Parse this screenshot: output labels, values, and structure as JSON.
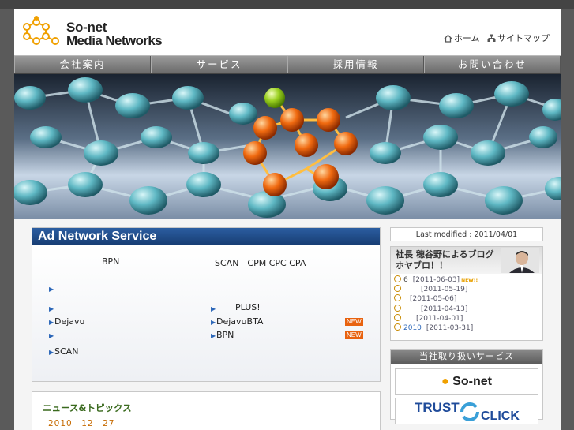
{
  "header": {
    "logo_line1": "So-net",
    "logo_line2": "Media Networks",
    "home_link": "ホーム",
    "sitemap_link": "サイトマップ"
  },
  "nav": [
    "会社案内",
    "サービス",
    "採用情報",
    "お問い合わせ"
  ],
  "ad_network": {
    "title": "Ad Network Service",
    "bpn": "BPN",
    "scan_line": "SCAN　CPM CPC CPA",
    "plus": "PLUS!",
    "dejavu": "Dejavu",
    "dejavubta": "DejavuBTA",
    "bpn2": "BPN",
    "scan": "SCAN",
    "new_badge": "NEW"
  },
  "news": {
    "heading": "ニュース&トピックス",
    "date": "2010　12　27"
  },
  "sidebar": {
    "last_modified": "Last modified : 2011/04/01",
    "blog_title_line1": "社長 穂谷野によるブログ",
    "blog_title_line2": "ホヤブロ！！",
    "blog_items": [
      {
        "prefix": "6",
        "date": "[2011-06-03]",
        "new": "NEW!!"
      },
      {
        "prefix": "",
        "date": "[2011-05-19]",
        "new": ""
      },
      {
        "prefix": "",
        "date": "[2011-05-06]",
        "new": ""
      },
      {
        "prefix": "",
        "date": "[2011-04-13]",
        "new": ""
      },
      {
        "prefix": "",
        "date": "[2011-04-01]",
        "new": ""
      },
      {
        "prefix": "2010",
        "date": "[2011-03-31]",
        "new": ""
      }
    ],
    "services_title": "当社取り扱いサービス",
    "sonet_logo": "So-net",
    "trust_logo": "TRUST",
    "click_logo": "CLICK"
  },
  "colors": {
    "nav_bg": "#7f7f7f",
    "panel_title_bg": "#1f4b8a",
    "new_badge": "#e8620f",
    "news_heading": "#3a6a1e",
    "news_date": "#c66a00",
    "logo_accent": "#f0a000"
  }
}
